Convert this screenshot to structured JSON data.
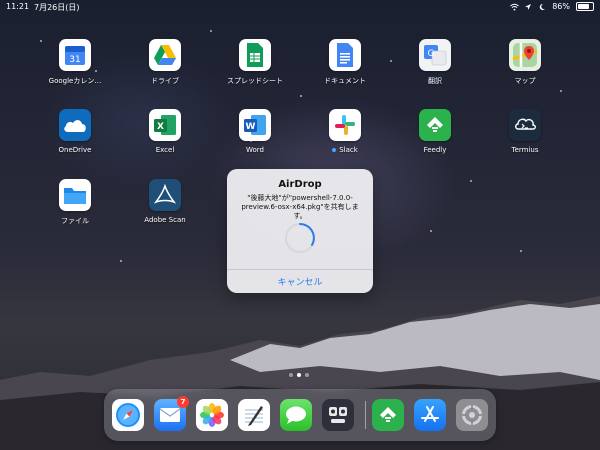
{
  "status_bar": {
    "time": "11:21",
    "date": "7月26日(日)",
    "battery_text": "86%"
  },
  "apps": [
    {
      "label": "Googleカレン…",
      "icon": "google-calendar-icon",
      "glyph": "31"
    },
    {
      "label": "ドライブ",
      "icon": "google-drive-icon",
      "glyph": "▲"
    },
    {
      "label": "スプレッドシート",
      "icon": "google-sheets-icon",
      "glyph": "▦"
    },
    {
      "label": "ドキュメント",
      "icon": "google-docs-icon",
      "glyph": "≡"
    },
    {
      "label": "翻訳",
      "icon": "google-translate-icon",
      "glyph": "G"
    },
    {
      "label": "マップ",
      "icon": "google-maps-icon",
      "glyph": "◆"
    },
    {
      "label": "OneDrive",
      "icon": "onedrive-icon",
      "glyph": "☁"
    },
    {
      "label": "Excel",
      "icon": "excel-icon",
      "glyph": "X"
    },
    {
      "label": "Word",
      "icon": "word-icon",
      "glyph": "W"
    },
    {
      "label": "Slack",
      "icon": "slack-icon",
      "glyph": "#"
    },
    {
      "label": "Feedly",
      "icon": "feedly-icon",
      "glyph": "f"
    },
    {
      "label": "Termius",
      "icon": "termius-icon",
      "glyph": ">_"
    },
    {
      "label": "ファイル",
      "icon": "files-icon",
      "glyph": "▬"
    },
    {
      "label": "Adobe Scan",
      "icon": "adobe-scan-icon",
      "glyph": "A"
    }
  ],
  "dialog": {
    "title": "AirDrop",
    "message": "\"後藤大地\"が\"powershell-7.0.0-preview.6-osx-x64.pkg\"を共有します。",
    "cancel_label": "キャンセル"
  },
  "dock": {
    "apps": [
      {
        "icon": "safari-icon"
      },
      {
        "icon": "mail-icon"
      },
      {
        "icon": "photos-icon"
      },
      {
        "icon": "notes-writing-icon"
      },
      {
        "icon": "messages-icon"
      },
      {
        "icon": "robot-app-icon"
      },
      {
        "icon": "feedly-icon"
      },
      {
        "icon": "app-store-icon"
      },
      {
        "icon": "settings-icon"
      }
    ],
    "mail_badge": "7"
  },
  "colors": {
    "accent_blue": "#2c7cf0",
    "badge_red": "#ff3b30"
  }
}
